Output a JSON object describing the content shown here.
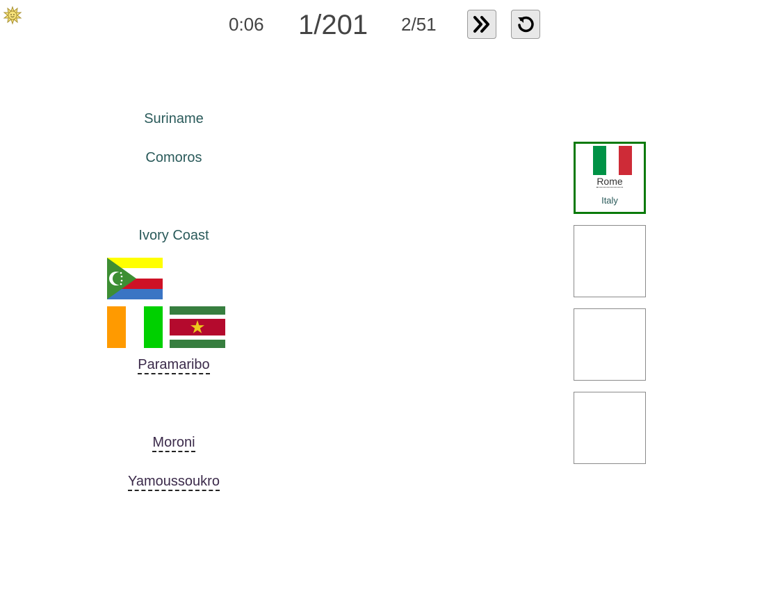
{
  "header": {
    "timer": "0:06",
    "progress": "1/201",
    "score": "2/51",
    "skip_icon": "double-chevron-right-icon",
    "restart_icon": "restart-icon",
    "logo_icon": "sun-icon"
  },
  "countries": {
    "suriname": "Suriname",
    "comoros": "Comoros",
    "ivory_coast": "Ivory Coast"
  },
  "capitals": {
    "paramaribo": "Paramaribo",
    "moroni": "Moroni",
    "yamoussoukro": "Yamoussoukro"
  },
  "flags": {
    "comoros": "comoros-flag",
    "ivory_coast": "ivory-coast-flag",
    "suriname": "suriname-flag"
  },
  "slots": [
    {
      "flag": "italy-flag",
      "capital": "Rome",
      "country": "Italy",
      "matched": true
    },
    {
      "matched": false
    },
    {
      "matched": false
    },
    {
      "matched": false
    }
  ],
  "colors": {
    "match_border": "#0a7a0a",
    "country_text": "#2a5a5a",
    "capital_text": "#3b2a4a"
  }
}
